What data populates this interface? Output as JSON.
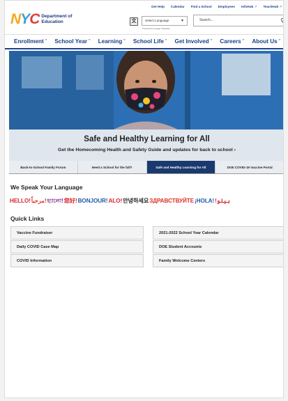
{
  "header": {
    "logo_mark": [
      "N",
      "Y",
      "C"
    ],
    "logo_text": [
      "Department of",
      "Education"
    ],
    "util_links": [
      {
        "label": "Get Help",
        "external": false
      },
      {
        "label": "Calendar",
        "external": false
      },
      {
        "label": "Find a School",
        "external": false
      },
      {
        "label": "Employees",
        "external": false
      },
      {
        "label": "InfoHub",
        "external": true
      },
      {
        "label": "TeachHub",
        "external": true
      }
    ],
    "translate_icon": "translate-icon",
    "language_select": {
      "value": "Select Language"
    },
    "powered_by": "Powered by Google Translate",
    "search": {
      "placeholder": "Search..."
    }
  },
  "nav": {
    "items": [
      "Enrollment",
      "School Year",
      "Learning",
      "School Life",
      "Get Involved",
      "Careers",
      "About Us"
    ]
  },
  "hero": {
    "title": "Safe and Healthy Learning for All",
    "subtitle": "Get the Homecoming Health and Safety Guide and updates for back to school",
    "subtitle_arrow": "›"
  },
  "subtabs": {
    "items": [
      {
        "label": "Back-to-School Family Forum",
        "active": false
      },
      {
        "label": "Need a School for the fall?",
        "active": false
      },
      {
        "label": "Safe and Healthy Learning for All",
        "active": true
      },
      {
        "label": "DOE COVID-19 Vaccine Portal",
        "active": false
      }
    ]
  },
  "languages": {
    "title": "We Speak Your Language",
    "greetings": [
      {
        "text": "HELLO!",
        "color": "#d7262e"
      },
      {
        "text": "مرحباً!",
        "color": "#e0322b"
      },
      {
        "text": "হ্যালো!",
        "color": "#8a3b97"
      },
      {
        "text": "您好!",
        "color": "#d7262e"
      },
      {
        "text": "BONJOUR!",
        "color": "#1e5aa8"
      },
      {
        "text": "ALO!",
        "color": "#d7262e"
      },
      {
        "text": "안녕하세요",
        "color": "#2a2a2a"
      },
      {
        "text": "ЗДРАВСТВУЙТЕ",
        "color": "#e0322b"
      },
      {
        "text": "¡HOLA!",
        "color": "#1e5aa8"
      },
      {
        "text": "!ہیلو",
        "color": "#d7262e"
      }
    ]
  },
  "quick_links": {
    "title": "Quick Links",
    "left": [
      "Vaccine Fundraiser",
      "Daily COVID Case Map",
      "COVID Information"
    ],
    "right": [
      "2021-2022 School Year Calendar",
      "DOE Student Accounts",
      "Family Welcome Centers"
    ]
  }
}
